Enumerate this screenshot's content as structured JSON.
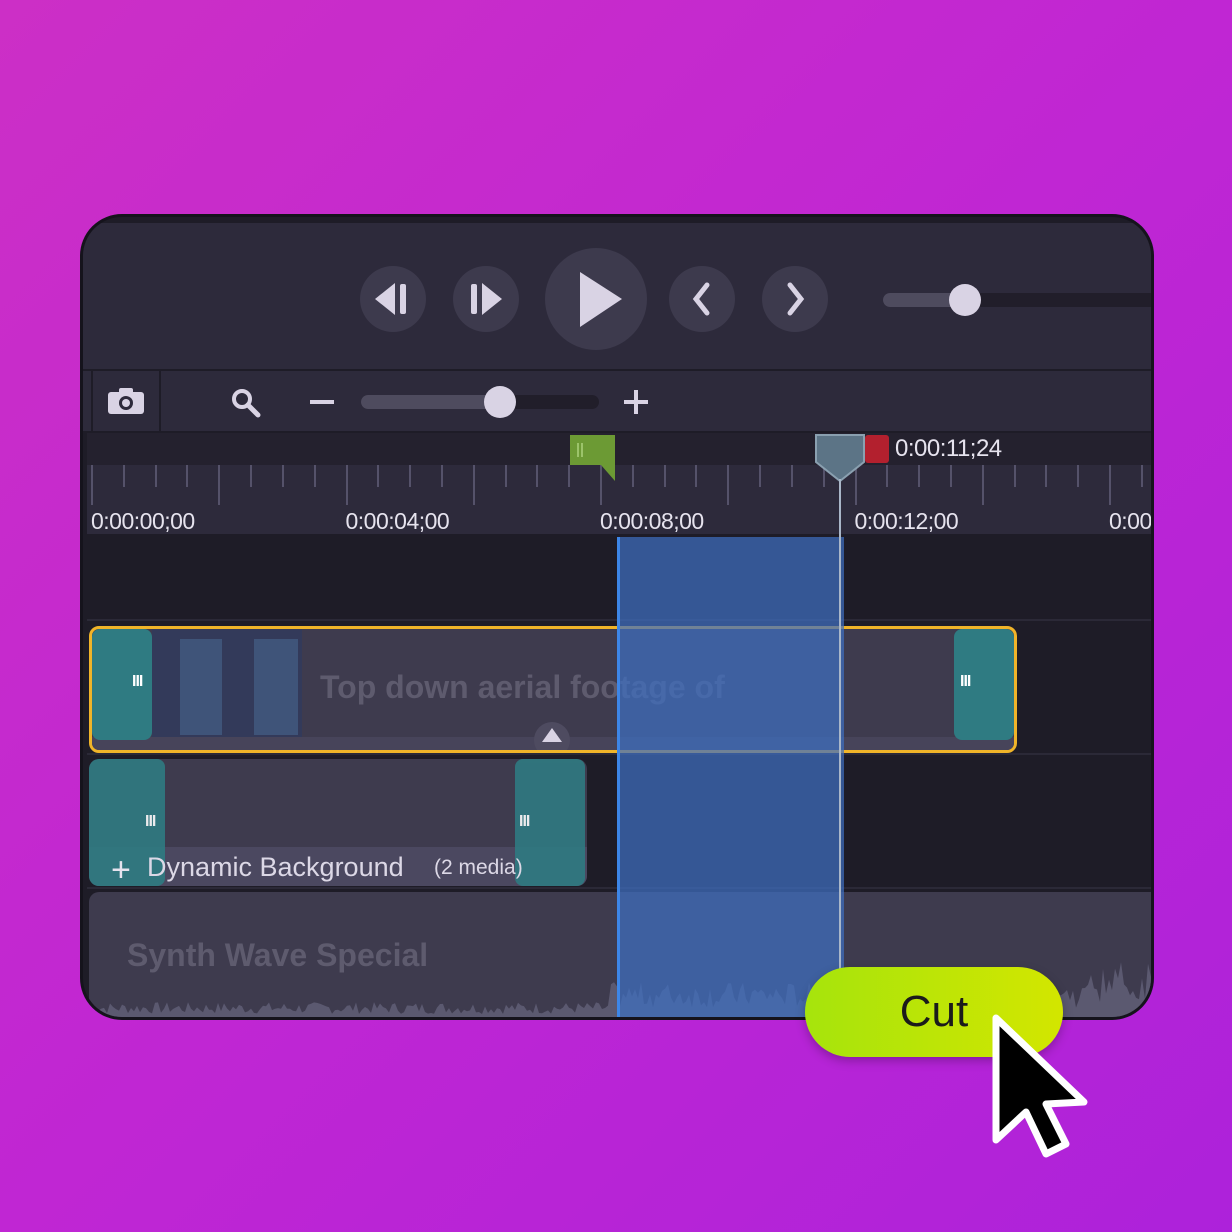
{
  "colors": {
    "background": "#c026d3",
    "clip_border": "#f0b429",
    "selection": "#3f6fc0",
    "cut_button": "#c4e600",
    "handle": "#2f7b82"
  },
  "controls": {
    "buttons": [
      "step-back",
      "step-forward",
      "play",
      "previous",
      "next"
    ],
    "volume": 0.3
  },
  "toolbar": {
    "zoom_level": 0.6
  },
  "timeline": {
    "playhead_time": "0:00:11;24",
    "ruler_labels": [
      "0:00:00;00",
      "0:00:04;00",
      "0:00:08;00",
      "0:00:12;00",
      "0:00"
    ]
  },
  "tracks": {
    "video_clip": {
      "title": "Top down aerial footage of"
    },
    "group_clip": {
      "title": "Dynamic Background",
      "count": "(2 media)"
    },
    "audio_clip": {
      "title": "Synth Wave Special"
    }
  },
  "cut_button": {
    "label": "Cut"
  }
}
